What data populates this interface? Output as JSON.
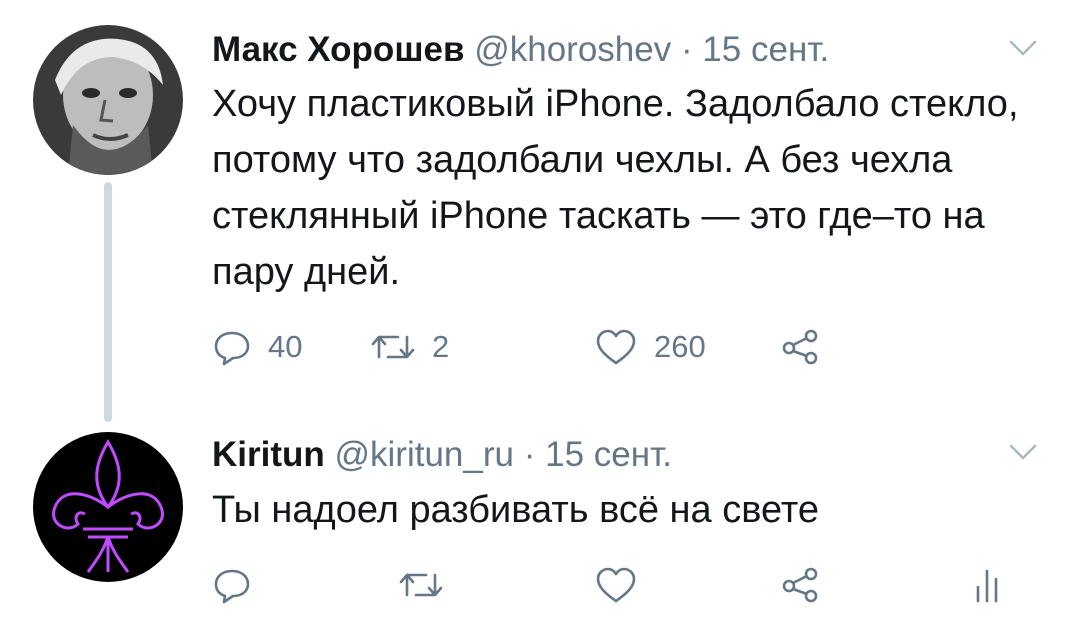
{
  "tweets": [
    {
      "name": "Макс Хорошев",
      "handle": "@khoroshev",
      "separator": "·",
      "date": "15 сент.",
      "text": "Хочу пластиковый iPhone. Задолбало стекло, потому что задолбали чехлы. А без чехла стеклянный iPhone таскать — это где–то на пару дней.",
      "replies": "40",
      "retweets": "2",
      "likes": "260",
      "icons": [
        "reply-icon",
        "retweet-icon",
        "like-icon",
        "share-icon",
        "chevron-down-icon"
      ]
    },
    {
      "name": "Kiritun",
      "handle": "@kiritun_ru",
      "separator": "·",
      "date": "15 сент.",
      "text": "Ты надоел разбивать всё на свете",
      "icons": [
        "reply-icon",
        "retweet-icon",
        "like-icon",
        "share-icon",
        "analytics-icon",
        "chevron-down-icon"
      ]
    }
  ],
  "colors": {
    "text": "#14171a",
    "secondary": "#657786",
    "thread_line": "#cfd9de",
    "fleur_glow": "#c14bff"
  }
}
